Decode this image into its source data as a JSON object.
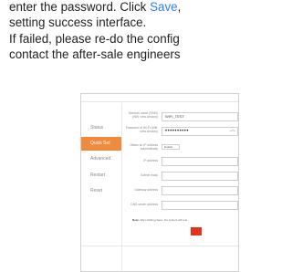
{
  "doc": {
    "line1_pre": "enter the password. Click ",
    "line1_link": "Save",
    "line1_post": ",",
    "line2": "setting success interface.",
    "line3": "If failed, please re-do the config",
    "line4": "contact the after-sale engineers"
  },
  "screenshot": {
    "sidebar": {
      "items": [
        {
          "label": "Status",
          "active": false
        },
        {
          "label": "Quick Set",
          "active": true
        },
        {
          "label": "Advanced",
          "active": false
        },
        {
          "label": "Restart",
          "active": false
        },
        {
          "label": "Reset",
          "active": false
        }
      ]
    },
    "form": {
      "ssid_label": "Network name (SSID) (Wifi: view window)",
      "ssid_value": "WIFI_TEST",
      "password_label": "Password of Wi-Fi (Wifi: view window)",
      "password_value": "••••••••••",
      "obtain_ip_label": "Obtain an IP address automatically",
      "obtain_ip_value": "Enable",
      "ip_label": "IP address",
      "subnet_label": "Subnet mask",
      "gateway_label": "Gateway address",
      "dns_label": "DNS server address",
      "note_bold": "Note: ",
      "note_text": "After clicking Save, the system will rest"
    },
    "colors": {
      "active_tab": "#f08a3c",
      "save_button": "#e2331c",
      "link": "#2f80ed"
    }
  }
}
